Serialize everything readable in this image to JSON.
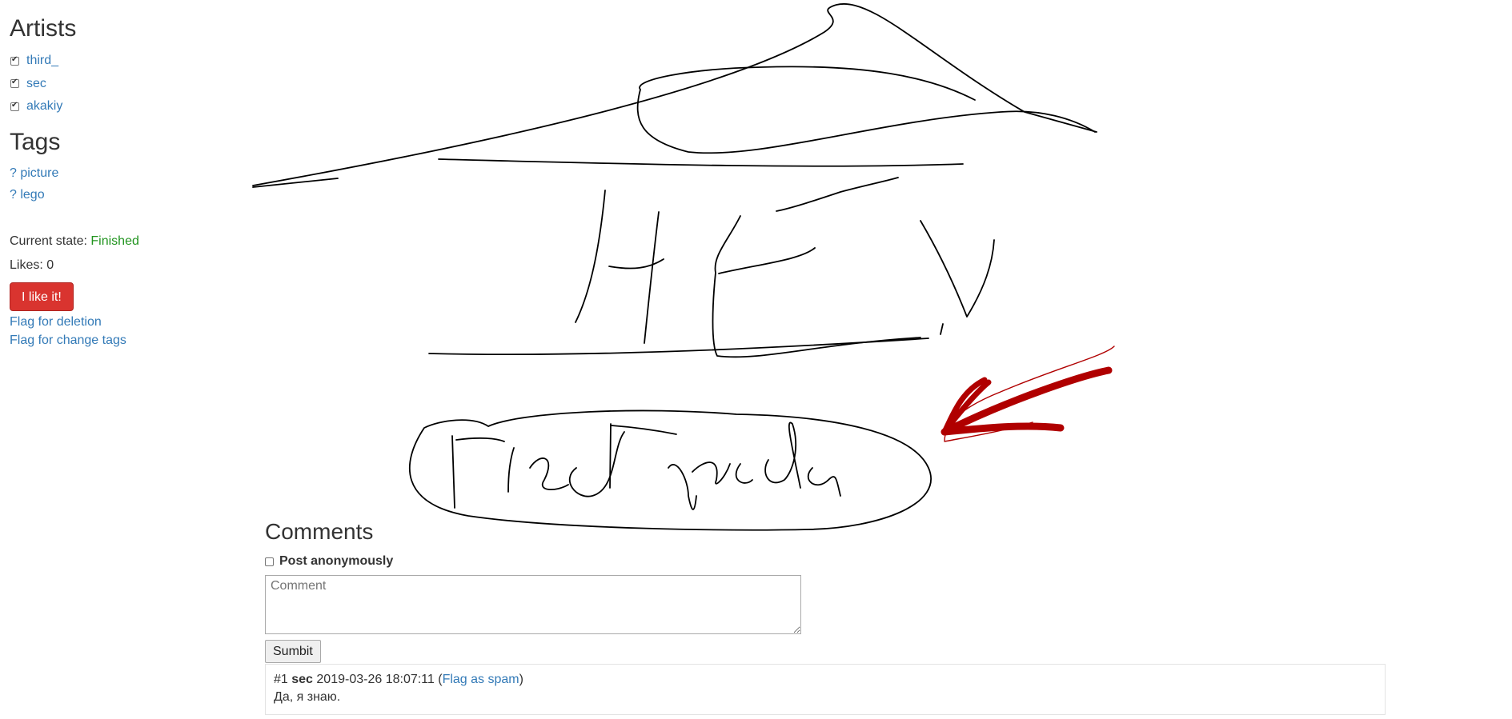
{
  "sidebar": {
    "artists_heading": "Artists",
    "artists": [
      {
        "name": "third_",
        "checked": true
      },
      {
        "name": "sec",
        "checked": true
      },
      {
        "name": "akakiy",
        "checked": true
      }
    ],
    "tags_heading": "Tags",
    "tags": [
      {
        "label": "? picture"
      },
      {
        "label": "? lego"
      }
    ],
    "state_label": "Current state:",
    "state_value": "Finished",
    "likes_label": "Likes: 0",
    "like_button": "I like it!",
    "flag_deletion": "Flag for deletion",
    "flag_tags": "Flag for change tags"
  },
  "drawing": {
    "handwritten_text": [
      "HEY",
      "Глеб Гирсова"
    ],
    "stroke_color": "#000000",
    "arrow_color": "#b00000"
  },
  "comments": {
    "heading": "Comments",
    "post_anonymously": "Post anonymously",
    "placeholder": "Comment",
    "submit": "Sumbit",
    "items": [
      {
        "index": "#1",
        "author": "sec",
        "timestamp": "2019-03-26 18:07:11",
        "flag_label": "Flag as spam",
        "text": "Да, я знаю."
      }
    ]
  },
  "colors": {
    "link": "#337ab7",
    "state_finished": "#21941f",
    "like_button": "#d9342f"
  }
}
